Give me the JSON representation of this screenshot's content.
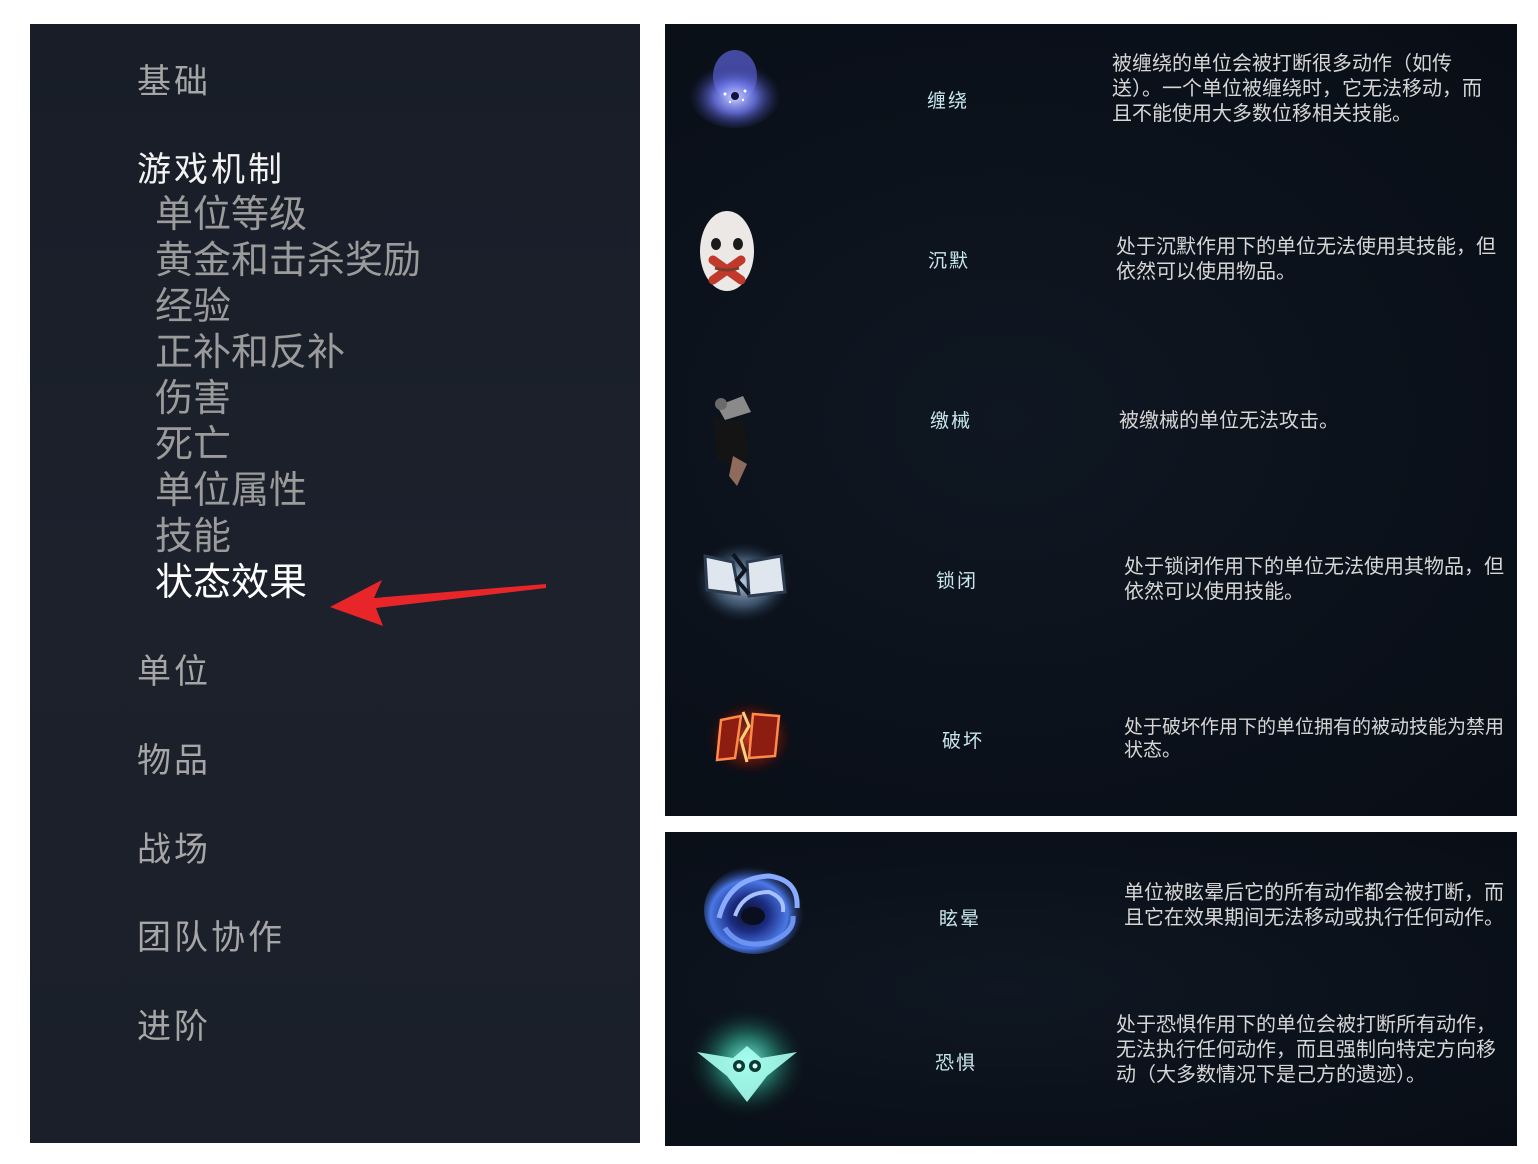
{
  "sidebar": {
    "sections": [
      {
        "label": "基础"
      },
      {
        "label": "游戏机制"
      },
      {
        "label": "单位"
      },
      {
        "label": "物品"
      },
      {
        "label": "战场"
      },
      {
        "label": "团队协作"
      },
      {
        "label": "进阶"
      }
    ],
    "mechanics_items": [
      {
        "label": "单位等级"
      },
      {
        "label": "黄金和击杀奖励"
      },
      {
        "label": "经验"
      },
      {
        "label": "正补和反补"
      },
      {
        "label": "伤害"
      },
      {
        "label": "死亡"
      },
      {
        "label": "单位属性"
      },
      {
        "label": "技能"
      },
      {
        "label": "状态效果"
      }
    ],
    "current_item": "状态效果"
  },
  "status_effects": [
    {
      "name": "缠绕",
      "icon": "root-icon",
      "description": "被缠绕的单位会被打断很多动作（如传送）。一个单位被缠绕时，它无法移动，而且不能使用大多数位移相关技能。"
    },
    {
      "name": "沉默",
      "icon": "silence-mask-icon",
      "description": "处于沉默作用下的单位无法使用其技能，但依然可以使用物品。"
    },
    {
      "name": "缴械",
      "icon": "disarm-icon",
      "description": "被缴械的单位无法攻击。"
    },
    {
      "name": "锁闭",
      "icon": "broken-book-icon",
      "description": "处于锁闭作用下的单位无法使用其物品，但依然可以使用技能。"
    },
    {
      "name": "破坏",
      "icon": "break-icon",
      "description": "处于破坏作用下的单位拥有的被动技能为禁用状态。"
    },
    {
      "name": "眩晕",
      "icon": "stun-swirl-icon",
      "description": "单位被眩晕后它的所有动作都会被打断，而且它在效果期间无法移动或执行任何动作。"
    },
    {
      "name": "恐惧",
      "icon": "fear-owl-icon",
      "description": "处于恐惧作用下的单位会被打断所有动作，无法执行任何动作，而且强制向特定方向移动（大多数情况下是己方的遗迹）。"
    }
  ],
  "colors": {
    "sidebar_bg": "#1a1f29",
    "panel_bg": "#0b111a",
    "arrow": "#e8262a",
    "effect_name": "#c9e6ee"
  }
}
